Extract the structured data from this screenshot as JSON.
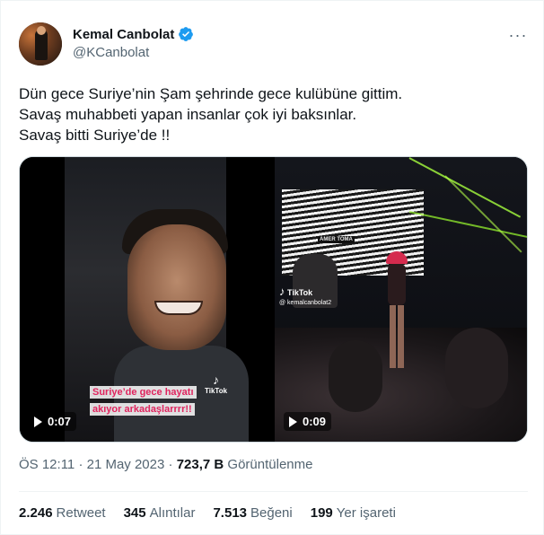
{
  "author": {
    "name": "Kemal Canbolat",
    "handle": "@KCanbolat",
    "verified": true
  },
  "more_icon": "···",
  "tweet_text": [
    "Dün gece Suriye’nin Şam şehrinde gece kulübüne gittim.",
    "Savaş muhabbeti yapan insanlar çok iyi baksınlar.",
    "Savaş bitti Suriye’de !!"
  ],
  "media": {
    "video1": {
      "duration": "0:07",
      "caption_lines": [
        "Suriye’de gece hayatı",
        "akıyor arkadaşlarrrr!!"
      ],
      "watermark": "TikTok"
    },
    "video2": {
      "duration": "0:09",
      "screen_text": "AMER TOMA",
      "watermark": "TikTok",
      "watermark_user": "@ kemalcanbolat2"
    }
  },
  "meta": {
    "time": "ÖS 12:11",
    "date": "21 May 2023",
    "separator": "·",
    "views": "723,7 B",
    "views_label": "Görüntülenme"
  },
  "stats": [
    {
      "value": "2.246",
      "label": "Retweet"
    },
    {
      "value": "345",
      "label": "Alıntılar"
    },
    {
      "value": "7.513",
      "label": "Beğeni"
    },
    {
      "value": "199",
      "label": "Yer işareti"
    }
  ],
  "colors": {
    "verified": "#1d9bf0",
    "secondary_text": "#536471",
    "primary_text": "#0f1419"
  }
}
